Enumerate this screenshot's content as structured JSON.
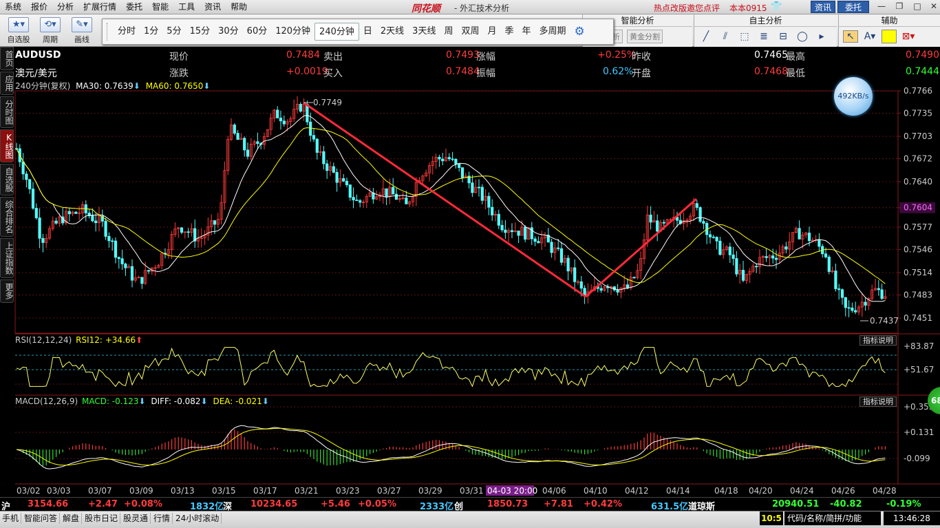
{
  "menu": [
    "系统",
    "报价",
    "分析",
    "扩展行情",
    "委托",
    "智能",
    "工具",
    "资讯",
    "帮助"
  ],
  "brand": "同花顺",
  "app_title": "- 外汇技术分析",
  "hot_news": "热点改版邀您点评",
  "version": "本本0915",
  "info_btn": "资讯",
  "trade_btn": "委托",
  "toolbar": {
    "tools": [
      {
        "label": "自选股",
        "icon": "star-icon"
      },
      {
        "label": "周期",
        "icon": "cycle-icon"
      },
      {
        "label": "画线",
        "icon": "pencil-icon"
      }
    ],
    "periods": [
      "分时",
      "1分",
      "5分",
      "15分",
      "30分",
      "60分",
      "120分钟",
      "240分钟",
      "日",
      "2天线",
      "3天线",
      "周",
      "双周",
      "月",
      "季",
      "年",
      "多周期"
    ],
    "active_period": "240分钟"
  },
  "smart_panel": {
    "title": "智能分析",
    "btns": [
      "压力分析",
      "黄金分割"
    ]
  },
  "self_panel": {
    "title": "自主分析"
  },
  "aux_panel": {
    "title": "辅助"
  },
  "left_tabs": [
    "首页",
    "应用",
    "分时图",
    "K线图",
    "自选股",
    "综合排名",
    "上证指数",
    "更多"
  ],
  "quote": {
    "symbol": "AUDUSD",
    "name": "澳元/美元",
    "rows": [
      [
        {
          "l": "现价",
          "v": "0.7484",
          "c": "#ff3b3b"
        },
        {
          "l": "卖出",
          "v": "0.7493",
          "c": "#ff3b3b"
        },
        {
          "l": "涨幅",
          "v": "+0.25%",
          "c": "#ff3b3b"
        },
        {
          "l": "昨收",
          "v": "0.7465",
          "c": "#ffffff"
        },
        {
          "l": "最高",
          "v": "0.7490",
          "c": "#ff3b3b"
        }
      ],
      [
        {
          "l": "涨跌",
          "v": "+0.0019",
          "c": "#ff3b3b"
        },
        {
          "l": "买入",
          "v": "0.7484",
          "c": "#ff3b3b"
        },
        {
          "l": "振幅",
          "v": "0.62%",
          "c": "#44c8ff"
        },
        {
          "l": "开盘",
          "v": "0.7468",
          "c": "#ff3b3b"
        },
        {
          "l": "最低",
          "v": "0.7444",
          "c": "#33ff33"
        }
      ]
    ]
  },
  "ma_line": {
    "period": "240分钟(复权)",
    "ma30": "MA30: 0.7639",
    "ma60": "MA60: 0.7650"
  },
  "net_speed": "492KB/s",
  "badge": "68",
  "rsi": {
    "title": "RSI(12,12,24)",
    "value": "RSI12: +34.66",
    "btn": "指标说明"
  },
  "macd": {
    "title": "MACD(12,26,9)",
    "macd": "MACD: -0.123",
    "diff": "DIFF: -0.082",
    "dea": "DEA: -0.021",
    "btn": "指标说明"
  },
  "price_axis": [
    "0.7766",
    "0.7735",
    "0.7703",
    "0.7672",
    "0.7640",
    "0.7604",
    "0.7577",
    "0.7546",
    "0.7514",
    "0.7483",
    "0.7451"
  ],
  "current_price_label": "0.7604",
  "rsi_axis": [
    "+83.87",
    "+51.67"
  ],
  "macd_axis": [
    "+0.355",
    "+0.131",
    "-0.099"
  ],
  "dates": [
    "03/02",
    "03/03",
    "03/07",
    "03/09",
    "03/13",
    "03/15",
    "03/17",
    "03/21",
    "03/23",
    "03/27",
    "03/29",
    "03/31",
    "04-03 20:00",
    "04/06",
    "04/10",
    "04/12",
    "04/14",
    "04/18",
    "04/20",
    "04/24",
    "04/26",
    "04/28"
  ],
  "annot_high": "0.7749",
  "annot_low": "0.7437",
  "bottom": {
    "sh_label": "沪",
    "sh_val": "3154.66",
    "sh_chg": "+2.47",
    "sh_pct": "+0.08%",
    "sh_amt": "1832亿",
    "sz_label": "深",
    "sz_val": "10234.65",
    "sz_chg": "+5.46",
    "sz_pct": "+0.05%",
    "sz_amt": "2333亿",
    "cy_label": "创",
    "cy_val": "1850.73",
    "cy_chg": "+7.81",
    "cy_pct": "+0.42%",
    "cy_amt": "631.5亿",
    "dj_label": "道琼斯",
    "dj_val": "20940.51",
    "dj_chg": "-40.82",
    "dj_pct": "-0.19%"
  },
  "status": {
    "items": [
      "手机",
      "智能问答",
      "解盘",
      "股市日记",
      "股灵通",
      "行情",
      "24小时滚动"
    ],
    "clock_short": "10:5",
    "search": "代码/名称/简拼/功能",
    "time": "13:46:28"
  }
}
